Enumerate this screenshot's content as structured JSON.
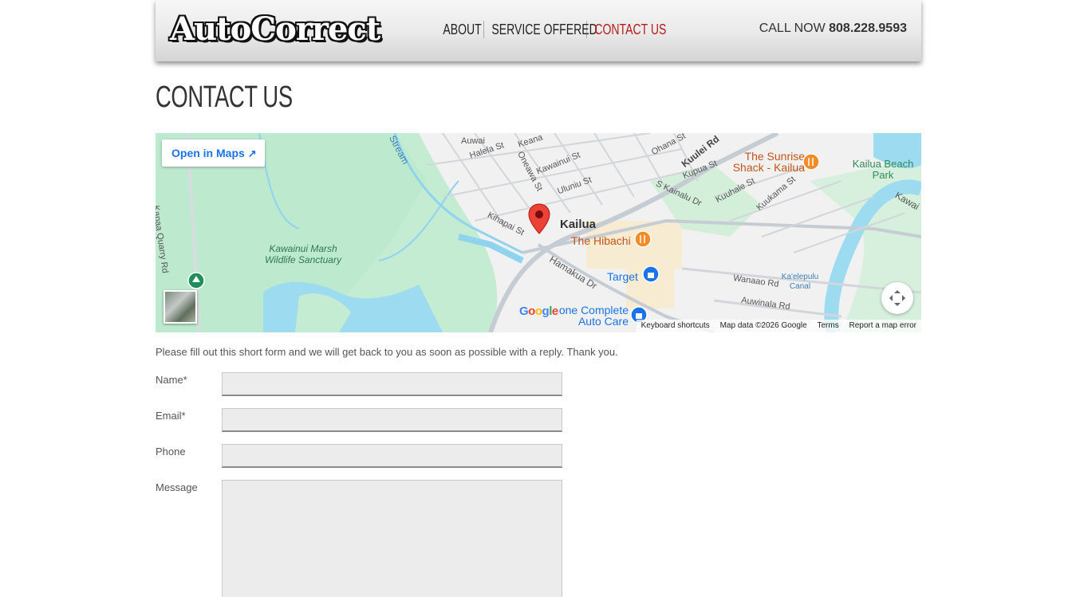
{
  "header": {
    "logo_text": "AutoCorrect",
    "nav": [
      {
        "label": "ABOUT"
      },
      {
        "label": "SERVICE OFFERED"
      },
      {
        "label": "CONTACT US"
      }
    ],
    "call_prefix": "CALL NOW",
    "phone": "808.228.9593"
  },
  "page": {
    "title": "CONTACT US"
  },
  "map": {
    "open_in_maps": "Open in Maps",
    "streets": [
      "Auwai",
      "Halela St",
      "Keana",
      "Kawainui St",
      "Oneawa St",
      "Uluniu St",
      "Ohana St",
      "Kuulei Rd",
      "Kupua St",
      "S Kainalu Dr",
      "Kuuhale St",
      "Kuukama St",
      "Kihapai St",
      "Hamakua Dr",
      "Wanaao Rd",
      "Auwinala Rd",
      "Kapaa Quarry Rd",
      "Kawai",
      "Stream"
    ],
    "places": {
      "town": "Kailua",
      "sanctuary": "Kawainui Marsh Wildlife Sanctuary",
      "restaurant1": "The Sunrise Shack - Kailua",
      "restaurant2": "The Hibachi",
      "store": "Target",
      "auto": "one Complete Auto Care",
      "park": "Kailua Beach Park",
      "canal": "Ka'elepulu Canal"
    },
    "attribution": {
      "keyboard": "Keyboard shortcuts",
      "data": "Map data ©2026 Google",
      "terms": "Terms",
      "report": "Report a map error"
    }
  },
  "form": {
    "intro": "Please fill out this short form and we will get back to you as soon as possible with a reply. Thank you.",
    "fields": [
      {
        "label": "Name*",
        "value": ""
      },
      {
        "label": "Email*",
        "value": ""
      },
      {
        "label": "Phone",
        "value": ""
      },
      {
        "label": "Message",
        "value": ""
      }
    ]
  },
  "colors": {
    "accent_red": "#b51b1b",
    "link_blue": "#1a73e8",
    "input_bg": "#ececec"
  }
}
